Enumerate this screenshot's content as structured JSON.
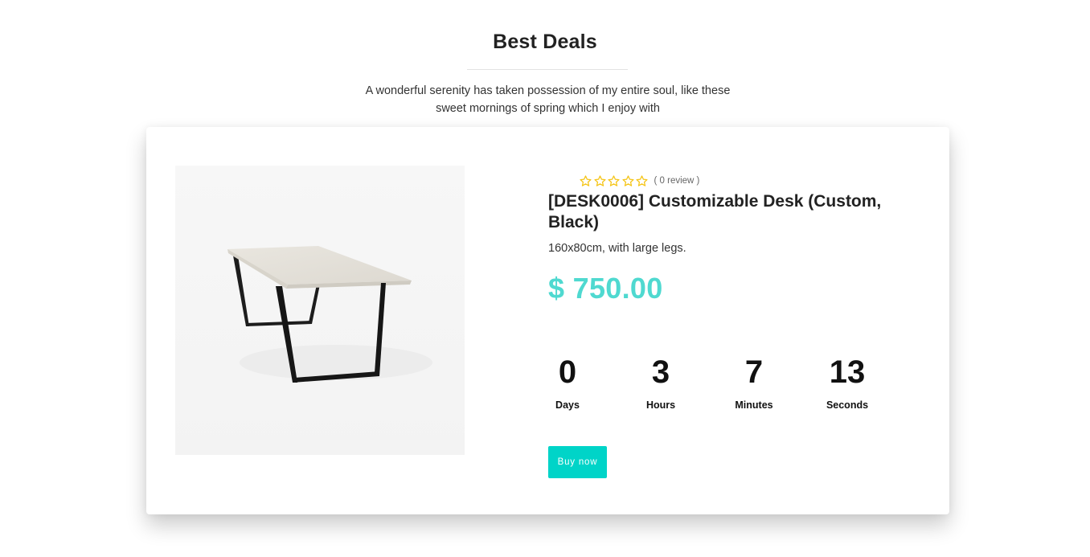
{
  "section": {
    "title": "Best Deals",
    "subtitle": "A wonderful serenity has taken possession of my entire soul, like these sweet mornings of spring which I enjoy with"
  },
  "product": {
    "rating": {
      "stars_filled": 0,
      "stars_total": 5,
      "review_text": "( 0 review )"
    },
    "name": "[DESK0006] Customizable Desk (Custom, Black)",
    "description": "160x80cm, with large legs.",
    "price": "$ 750.00",
    "image_alt": "desk-image"
  },
  "countdown": {
    "days": {
      "value": "0",
      "label": "Days"
    },
    "hours": {
      "value": "3",
      "label": "Hours"
    },
    "minutes": {
      "value": "7",
      "label": "Minutes"
    },
    "seconds": {
      "value": "13",
      "label": "Seconds"
    }
  },
  "actions": {
    "buy_label": "Buy now"
  },
  "colors": {
    "accent": "#00d4c8",
    "price": "#4fd9d0",
    "star": "#f5c518"
  },
  "icons": {
    "star": "star-outline-icon"
  }
}
